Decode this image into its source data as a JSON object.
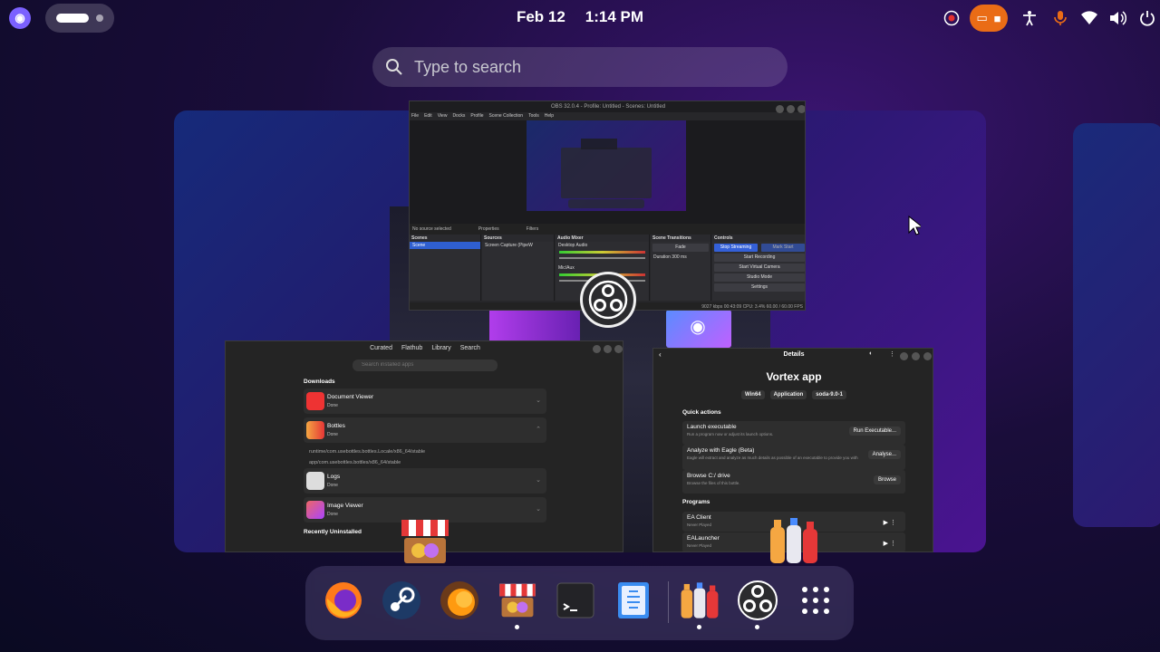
{
  "topbar": {
    "activities_icon": "activities-icon",
    "date": "Feb 12",
    "time": "1:14 PM",
    "tray_icons": [
      "screen-record-icon",
      "cast-icon",
      "recording-indicator-icon",
      "accessibility-icon",
      "microphone-icon",
      "wifi-icon",
      "volume-icon",
      "power-icon"
    ],
    "accent": "#ea6c16"
  },
  "search": {
    "placeholder": "Type to search"
  },
  "obs": {
    "title": "OBS 32.0.4 - Profile: Untitled - Scenes: Untitled",
    "menu": [
      "File",
      "Edit",
      "View",
      "Docks",
      "Profile",
      "Scene Collection",
      "Tools",
      "Help"
    ],
    "no_source": "No source selected",
    "properties": "Properties",
    "filters": "Filters",
    "scenes_header": "Scenes",
    "scene_item": "Scene",
    "sources_header": "Sources",
    "source_item": "Screen Capture (PipeW",
    "mixer_header": "Audio Mixer",
    "desktop_audio": "Desktop Audio",
    "desktop_db": "0.0 dB",
    "mic_aux": "Mic/Aux",
    "mic_db": "0.0 dB",
    "transitions_header": "Scene Transitions",
    "transition": "Fade",
    "duration_label": "Duration",
    "duration": "300 ms",
    "controls_header": "Controls",
    "stop_streaming": "Stop Streaming",
    "mark_start": "Mark Start",
    "start_recording": "Start Recording",
    "start_virtual_cam": "Start Virtual Camera",
    "studio_mode": "Studio Mode",
    "settings": "Settings",
    "status": "9027 kbps   00:43:09   CPU: 3.4%   60.00 / 60.00 FPS"
  },
  "bazaar": {
    "tabs": [
      "Curated",
      "Flathub",
      "Library",
      "Search"
    ],
    "search_placeholder": "Search installed apps",
    "downloads_header": "Downloads",
    "items": [
      {
        "name": "Document Viewer",
        "status": "Done"
      },
      {
        "name": "Bottles",
        "status": "Done"
      },
      {
        "name": "Logs",
        "status": "Done"
      },
      {
        "name": "Image Viewer",
        "status": "Done"
      }
    ],
    "bottles_sub": [
      "runtime/com.usebottles.bottles.Locale/x86_64/stable",
      "app/com.usebottles.bottles/x86_64/stable"
    ],
    "recently_uninstalled": "Recently Uninstalled"
  },
  "bottles": {
    "header": "Details",
    "title": "Vortex app",
    "tags": [
      "Win64",
      "Application",
      "soda-9.0-1"
    ],
    "quick_actions": "Quick actions",
    "actions": [
      {
        "title": "Launch executable",
        "desc": "Run a program now or adjust its launch options.",
        "button": "Run Executable..."
      },
      {
        "title": "Analyze with Eagle (Beta)",
        "desc": "Eagle will extract and analyze as much details as possible of an executable to provide you with a compatibility report.",
        "button": "Analyse..."
      },
      {
        "title": "Browse C:/ drive",
        "desc": "Browse the files of this bottle.",
        "button": "Browse"
      }
    ],
    "programs": "Programs",
    "program_list": [
      {
        "name": "EA Client",
        "status": "Never Played"
      },
      {
        "name": "EALauncher",
        "status": "Never Played"
      }
    ]
  },
  "dock": {
    "apps": [
      "firefox-icon",
      "steam-icon",
      "lutris-icon",
      "bazaar-icon",
      "terminal-icon",
      "text-editor-icon",
      "bottles-icon",
      "obs-icon",
      "app-grid-icon"
    ]
  }
}
